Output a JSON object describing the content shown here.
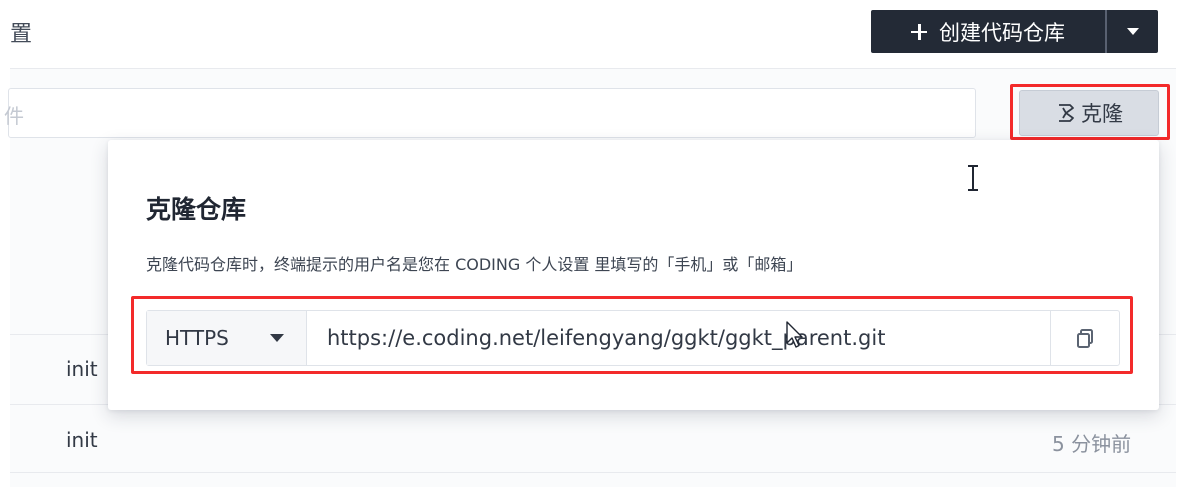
{
  "header": {
    "title": "置",
    "create_button_label": "创建代码仓库"
  },
  "search": {
    "placeholder_fragment": "件"
  },
  "clone_button": {
    "label": "克隆"
  },
  "list": {
    "rows": [
      {
        "message": "init",
        "time": ""
      },
      {
        "message": "init",
        "time": "5 分钟前"
      }
    ]
  },
  "clone_popover": {
    "title": "克隆仓库",
    "description": "克隆代码仓库时，终端提示的用户名是您在 CODING 个人设置 里填写的「手机」或「邮箱」",
    "protocol": "HTTPS",
    "url": "https://e.coding.net/leifengyang/ggkt/ggkt_parent.git"
  },
  "colors": {
    "primary_dark": "#232a36",
    "highlight_red": "#f32a2a",
    "text": "#323945",
    "muted": "#8b929e"
  },
  "icons": {
    "create": "plus-icon",
    "create_menu": "caret-down-icon",
    "clone": "clone-icon",
    "protocol_menu": "caret-down-icon",
    "copy": "copy-icon"
  }
}
